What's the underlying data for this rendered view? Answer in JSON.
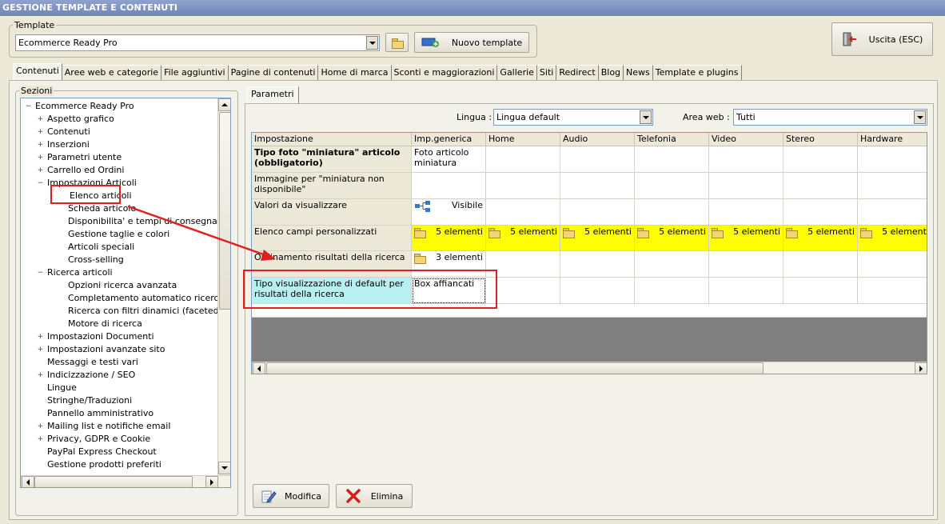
{
  "window": {
    "title": "GESTIONE TEMPLATE E CONTENUTI"
  },
  "template": {
    "label": "Template",
    "selected": "Ecommerce Ready Pro",
    "new_button": "Nuovo template"
  },
  "exit_button": "Uscita (ESC)",
  "main_tabs": [
    "Contenuti",
    "Aree web e categorie",
    "File aggiuntivi",
    "Pagine di contenuti",
    "Home di marca",
    "Sconti e maggiorazioni",
    "Gallerie",
    "Siti",
    "Redirect",
    "Blog",
    "News",
    "Template e plugins"
  ],
  "sections": {
    "label": "Sezioni",
    "tree": [
      {
        "label": "Ecommerce Ready Pro",
        "level": 0,
        "expander": "−"
      },
      {
        "label": "Aspetto grafico",
        "level": 1,
        "expander": "+"
      },
      {
        "label": "Contenuti",
        "level": 1,
        "expander": "+"
      },
      {
        "label": "Inserzioni",
        "level": 1,
        "expander": "+"
      },
      {
        "label": "Parametri utente",
        "level": 1,
        "expander": "+"
      },
      {
        "label": "Carrello ed Ordini",
        "level": 1,
        "expander": "+"
      },
      {
        "label": "Impostazioni Articoli",
        "level": 1,
        "expander": "−"
      },
      {
        "label": "Elenco articoli",
        "level": 2,
        "expander": "",
        "selected": true
      },
      {
        "label": "Scheda articolo",
        "level": 2,
        "expander": ""
      },
      {
        "label": "Disponibilita' e tempi di consegna",
        "level": 2,
        "expander": ""
      },
      {
        "label": "Gestione taglie e colori",
        "level": 2,
        "expander": ""
      },
      {
        "label": "Articoli speciali",
        "level": 2,
        "expander": ""
      },
      {
        "label": "Cross-selling",
        "level": 2,
        "expander": ""
      },
      {
        "label": "Ricerca articoli",
        "level": 1,
        "expander": "−"
      },
      {
        "label": "Opzioni ricerca avanzata",
        "level": 2,
        "expander": ""
      },
      {
        "label": "Completamento automatico ricerca",
        "level": 2,
        "expander": ""
      },
      {
        "label": "Ricerca con filtri dinamici (faceted search)",
        "level": 2,
        "expander": ""
      },
      {
        "label": "Motore di ricerca",
        "level": 2,
        "expander": ""
      },
      {
        "label": "Impostazioni Documenti",
        "level": 1,
        "expander": "+"
      },
      {
        "label": "Impostazioni avanzate sito",
        "level": 1,
        "expander": "+"
      },
      {
        "label": "Messaggi e testi vari",
        "level": 1,
        "expander": ""
      },
      {
        "label": "Indicizzazione / SEO",
        "level": 1,
        "expander": "+"
      },
      {
        "label": "Lingue",
        "level": 1,
        "expander": ""
      },
      {
        "label": "Stringhe/Traduzioni",
        "level": 1,
        "expander": ""
      },
      {
        "label": "Pannello amministrativo",
        "level": 1,
        "expander": ""
      },
      {
        "label": "Mailing list e notifiche email",
        "level": 1,
        "expander": "+"
      },
      {
        "label": "Privacy, GDPR e Cookie",
        "level": 1,
        "expander": "+"
      },
      {
        "label": "PayPal Express Checkout",
        "level": 1,
        "expander": ""
      },
      {
        "label": "Gestione prodotti preferiti",
        "level": 1,
        "expander": ""
      }
    ]
  },
  "params": {
    "tab": "Parametri",
    "lingua_label": "Lingua :",
    "lingua_value": "Lingua default",
    "area_label": "Area web :",
    "area_value": "Tutti",
    "columns": [
      "Impostazione",
      "Imp.generica",
      "Home",
      "Audio",
      "Telefonia",
      "Video",
      "Stereo",
      "Hardware"
    ],
    "rows": [
      {
        "name": "Tipo foto \"miniatura\" articolo (obbligatorio)",
        "bold": true,
        "generic": "Foto articolo miniatura",
        "icon": "",
        "others": ""
      },
      {
        "name": "Immagine per \"miniatura non disponibile\"",
        "bold": false,
        "generic": "",
        "icon": "",
        "others": ""
      },
      {
        "name": "Valori da visualizzare",
        "bold": false,
        "generic": "Visibile",
        "icon": "tree-icon",
        "others": ""
      },
      {
        "name": "Elenco campi personalizzati",
        "bold": false,
        "generic": "5 elementi",
        "icon": "folder-icon",
        "others": "5 elementi"
      },
      {
        "name": "Ordinamento risultati della ricerca",
        "bold": false,
        "generic": "3 elementi",
        "icon": "folder-icon",
        "others": ""
      },
      {
        "name": "Tipo visualizzazione di default per risultati della ricerca",
        "bold": false,
        "generic": "Box affiancati",
        "icon": "",
        "others": ""
      }
    ]
  },
  "actions": {
    "edit": "Modifica",
    "delete": "Elimina"
  },
  "colors": {
    "highlight_row": "#FFFF00",
    "selected_cell": "#B8F0F2",
    "annotation": "#E02020"
  }
}
